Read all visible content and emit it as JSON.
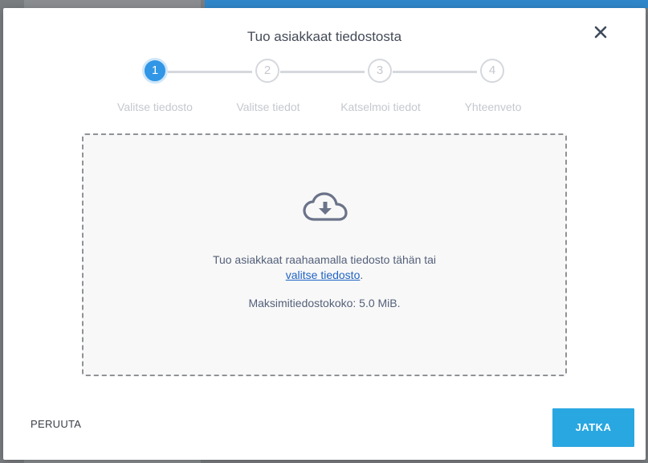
{
  "dialog": {
    "title": "Tuo asiakkaat tiedostosta",
    "close_label": "×"
  },
  "stepper": {
    "active_step": 1,
    "steps": [
      {
        "number": "1",
        "label": "Valitse tiedosto"
      },
      {
        "number": "2",
        "label": "Valitse tiedot"
      },
      {
        "number": "3",
        "label": "Katselmoi tiedot"
      },
      {
        "number": "4",
        "label": "Yhteenveto"
      }
    ]
  },
  "dropzone": {
    "icon": "cloud-download-icon",
    "text_before_link": "Tuo asiakkaat raahaamalla tiedosto tähän tai",
    "link_text": "valitse tiedosto",
    "text_after_link": ".",
    "max_size_text": "Maksimitiedostokoko: 5.0 MiB."
  },
  "footer": {
    "cancel_label": "PERUUTA",
    "continue_label": "JATKA"
  },
  "colors": {
    "accent": "#3196e6",
    "primary_button": "#29a7e1",
    "link": "#1f63c4",
    "step_inactive": "#c4c8ce"
  }
}
